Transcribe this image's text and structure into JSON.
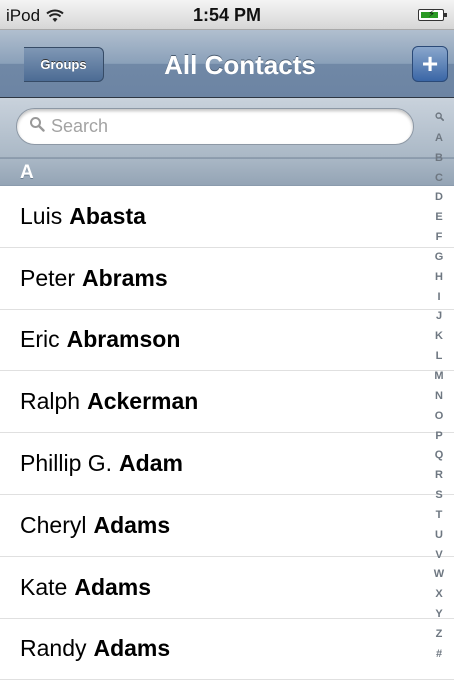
{
  "status_bar": {
    "carrier": "iPod",
    "time": "1:54 PM",
    "battery_level": 0.9
  },
  "nav": {
    "back_label": "Groups",
    "title": "All Contacts",
    "add_label": "+"
  },
  "search": {
    "placeholder": "Search"
  },
  "section": {
    "letter": "A"
  },
  "contacts": [
    {
      "first": "Luis",
      "last": "Abasta"
    },
    {
      "first": "Peter",
      "last": "Abrams"
    },
    {
      "first": "Eric",
      "last": "Abramson"
    },
    {
      "first": "Ralph",
      "last": "Ackerman"
    },
    {
      "first": "Phillip G.",
      "last": "Adam"
    },
    {
      "first": "Cheryl",
      "last": "Adams"
    },
    {
      "first": "Kate",
      "last": "Adams"
    },
    {
      "first": "Randy",
      "last": "Adams"
    }
  ],
  "index": [
    "A",
    "B",
    "C",
    "D",
    "E",
    "F",
    "G",
    "H",
    "I",
    "J",
    "K",
    "L",
    "M",
    "N",
    "O",
    "P",
    "Q",
    "R",
    "S",
    "T",
    "U",
    "V",
    "W",
    "X",
    "Y",
    "Z",
    "#"
  ],
  "colors": {
    "nav_bar": "#8aa0b9",
    "add_button": "#3a66a6",
    "battery": "#2c9a25"
  }
}
